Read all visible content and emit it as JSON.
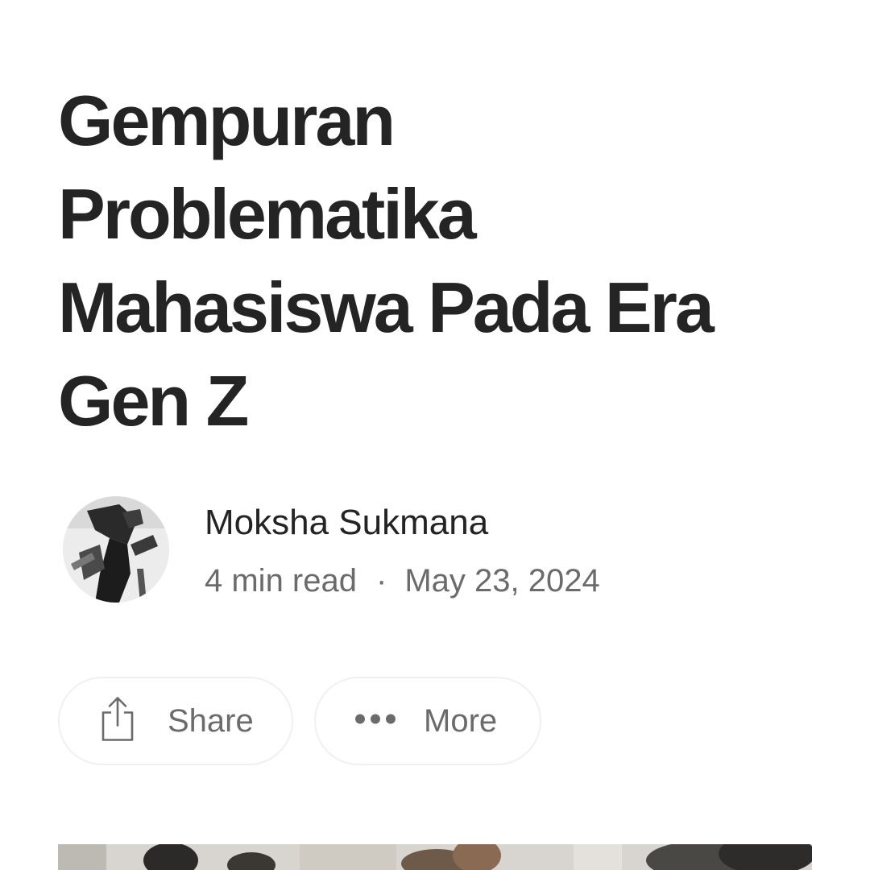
{
  "article": {
    "title_lines": [
      "Gempuran",
      "Problematika",
      "Mahasiswa Pada Era",
      "Gen Z"
    ]
  },
  "author": {
    "name": "Moksha Sukmana",
    "avatar_icon": "author-photo"
  },
  "meta": {
    "read_time": "4 min read",
    "separator": "·",
    "date": "May 23, 2024"
  },
  "actions": {
    "share_label": "Share",
    "share_icon": "share-icon",
    "more_label": "More",
    "more_icon": "more-dots-icon"
  },
  "colors": {
    "title": "#242424",
    "secondary_text": "#6b6b6b",
    "button_border": "#f0f0f0",
    "background": "#ffffff"
  }
}
